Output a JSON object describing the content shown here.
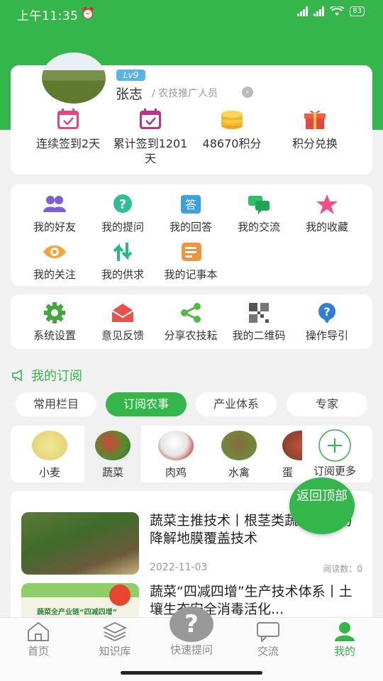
{
  "status_bar": {
    "time": "上午11:35",
    "battery": "83"
  },
  "profile": {
    "level": "Lv9",
    "name": "张志",
    "role": "/ 农技推广人员",
    "stats": [
      {
        "label": "连续签到2天",
        "icon": "calendar-check-icon"
      },
      {
        "label": "累计签到1201天",
        "icon": "calendar-check-icon"
      },
      {
        "label": "48670积分",
        "icon": "coins-icon"
      },
      {
        "label": "积分兑换",
        "icon": "gift-icon"
      }
    ]
  },
  "menu": [
    {
      "label": "我的好友",
      "icon": "friends-icon"
    },
    {
      "label": "我的提问",
      "icon": "question-icon"
    },
    {
      "label": "我的回答",
      "icon": "answer-icon"
    },
    {
      "label": "我的交流",
      "icon": "chat-icon"
    },
    {
      "label": "我的收藏",
      "icon": "star-icon"
    },
    {
      "label": "我的关注",
      "icon": "eye-icon"
    },
    {
      "label": "我的供求",
      "icon": "exchange-arrows-icon"
    },
    {
      "label": "我的记事本",
      "icon": "notebook-icon"
    }
  ],
  "tools": [
    {
      "label": "系统设置",
      "icon": "gear-icon"
    },
    {
      "label": "意见反馈",
      "icon": "envelope-icon"
    },
    {
      "label": "分享农技耘",
      "icon": "share-icon"
    },
    {
      "label": "我的二维码",
      "icon": "qrcode-icon"
    },
    {
      "label": "操作导引",
      "icon": "guide-icon"
    }
  ],
  "subscription": {
    "title": "我的订阅",
    "chips": [
      "常用栏目",
      "订阅农事",
      "产业体系",
      "专家"
    ],
    "active_chip": "订阅农事",
    "categories": [
      "小麦",
      "蔬菜",
      "肉鸡",
      "水禽",
      "蛋"
    ],
    "selected_category": "蔬菜",
    "more": "订阅更多"
  },
  "articles": [
    {
      "title": "蔬菜主推技术丨根茎类蔬菜全生物降解地膜覆盖技术",
      "date": "2022-11-03",
      "reads": "阅读数：0"
    },
    {
      "title": "蔬菜“四减四增”生产技术体系丨土壤生态安全消毒活化...",
      "thumb_text": "蔬菜全产业链“四减四增”"
    }
  ],
  "back_to_top": "返回顶部",
  "tabbar": [
    {
      "label": "首页",
      "icon": "home-icon"
    },
    {
      "label": "知识库",
      "icon": "layers-icon"
    },
    {
      "label": "快速提问",
      "icon": "question-icon"
    },
    {
      "label": "交流",
      "icon": "chat-icon"
    },
    {
      "label": "我的",
      "icon": "user-icon"
    }
  ],
  "colors": {
    "brand_green": "#34b64a"
  }
}
